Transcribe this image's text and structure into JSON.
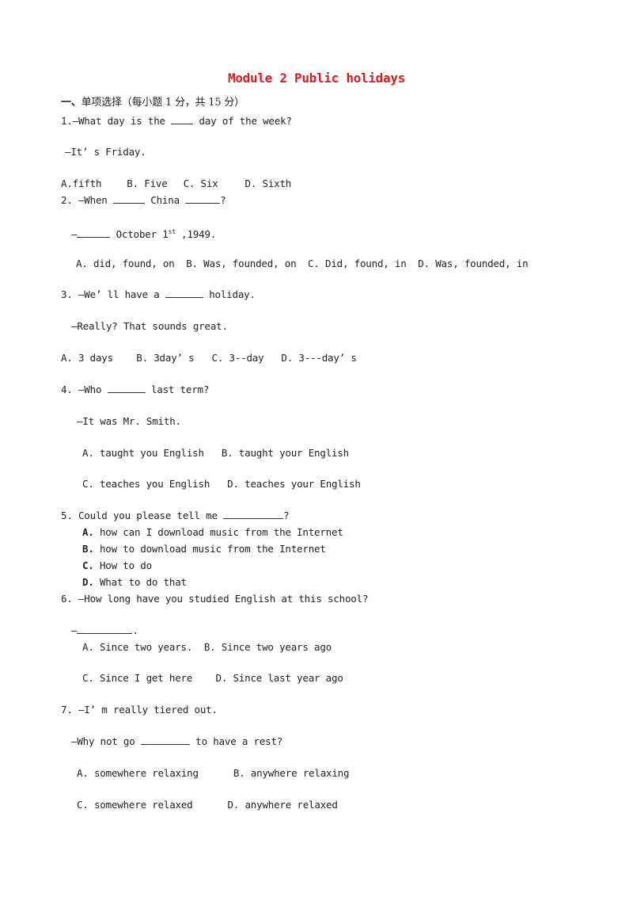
{
  "document": {
    "title": "Module 2 Public holidays",
    "title_color": "#e0191e",
    "section": {
      "marker": "一、",
      "heading": "单项选择（每小题 1 分，共 15 分）"
    },
    "questions": [
      {
        "number": "1.",
        "prompt_before": "—What day is the ",
        "prompt_after": " day of the week?",
        "reply": "—It’ s Friday.",
        "options": [
          "A.fifth",
          "B. Five",
          "C. Six",
          "D. Sixth"
        ]
      },
      {
        "number": "2.",
        "prompt_before": "—When ",
        "prompt_middle": " China ",
        "prompt_after": "?",
        "reply_before": "—",
        "reply_after": " October 1",
        "reply_sup": "st",
        "reply_end": " ,1949.",
        "options": [
          "A. did, found, on",
          "B. Was, founded, on",
          "C. Did, found, in",
          "D. Was, founded, in"
        ]
      },
      {
        "number": "3.",
        "prompt_before": "—We’ ll have a ",
        "prompt_after": " holiday.",
        "reply": "—Really? That sounds great.",
        "options": [
          "A. 3 days",
          "B. 3day’ s",
          "C. 3--day",
          "D. 3---day’ s"
        ]
      },
      {
        "number": "4.",
        "prompt_before": "—Who ",
        "prompt_after": " last term?",
        "reply": "—It was Mr. Smith.",
        "options": [
          "A. taught you English",
          "B. taught your English",
          "C. teaches you English",
          "D. teaches your English"
        ]
      },
      {
        "number": "5.",
        "prompt_before": "Could you please tell me ",
        "prompt_after": "?",
        "options": [
          "how can I download music from the Internet",
          "how to download music from the Internet",
          "How to do",
          "What to do that"
        ],
        "option_letters": [
          "A.",
          "B.",
          "C.",
          "D."
        ]
      },
      {
        "number": "6.",
        "prompt": "—How long have you studied English at this school?",
        "reply_before": "—",
        "reply_after": ".",
        "options": [
          "A. Since two years.",
          "B. Since two years ago",
          "C. Since I get here",
          "D. Since last year ago"
        ]
      },
      {
        "number": "7.",
        "prompt": "—I’ m really tiered out.",
        "reply_before": "—Why not go ",
        "reply_after": " to have a rest?",
        "options": [
          "A. somewhere relaxing",
          "B. anywhere relaxing",
          "C. somewhere relaxed",
          "D. anywhere relaxed"
        ]
      }
    ]
  }
}
